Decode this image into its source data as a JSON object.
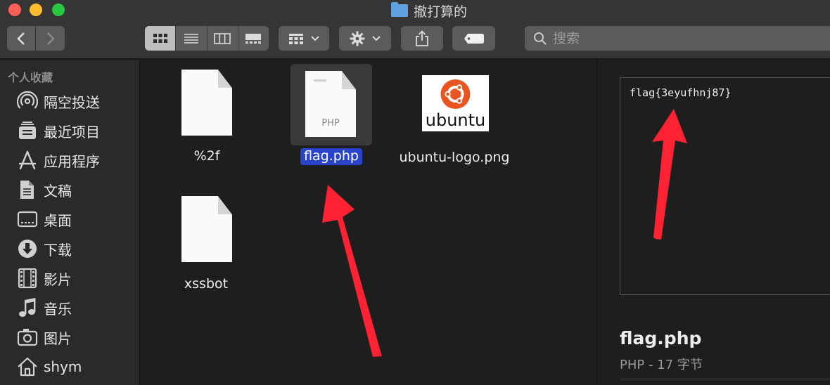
{
  "window": {
    "title": "撤打算的"
  },
  "toolbar": {
    "back_icon": "chevron-left-icon",
    "forward_icon": "chevron-right-icon",
    "view_modes": [
      "icon-view",
      "list-view",
      "column-view",
      "gallery-view"
    ],
    "active_view": "icon-view",
    "search_placeholder": "搜索"
  },
  "sidebar": {
    "heading": "个人收藏",
    "items": [
      {
        "label": "隔空投送",
        "icon": "airdrop-icon"
      },
      {
        "label": "最近项目",
        "icon": "recents-icon"
      },
      {
        "label": "应用程序",
        "icon": "applications-icon"
      },
      {
        "label": "文稿",
        "icon": "documents-icon"
      },
      {
        "label": "桌面",
        "icon": "desktop-icon"
      },
      {
        "label": "下载",
        "icon": "downloads-icon"
      },
      {
        "label": "影片",
        "icon": "movies-icon"
      },
      {
        "label": "音乐",
        "icon": "music-icon"
      },
      {
        "label": "图片",
        "icon": "pictures-icon"
      },
      {
        "label": "shym",
        "icon": "home-icon"
      }
    ]
  },
  "files": [
    {
      "name": "%2f",
      "kind": "document",
      "ext": ""
    },
    {
      "name": "flag.php",
      "kind": "document",
      "ext": "PHP",
      "selected": true
    },
    {
      "name": "ubuntu-logo.png",
      "kind": "image",
      "logo_text": "ubuntu"
    },
    {
      "name": "xssbot",
      "kind": "document",
      "ext": ""
    }
  ],
  "preview": {
    "content": "flag{3eyufhnj87}",
    "name": "flag.php",
    "meta": "PHP - 17 字节"
  },
  "colors": {
    "selection": "#2a44c9",
    "annotation_arrow": "#ff2233",
    "ubuntu_orange": "#e95420"
  }
}
